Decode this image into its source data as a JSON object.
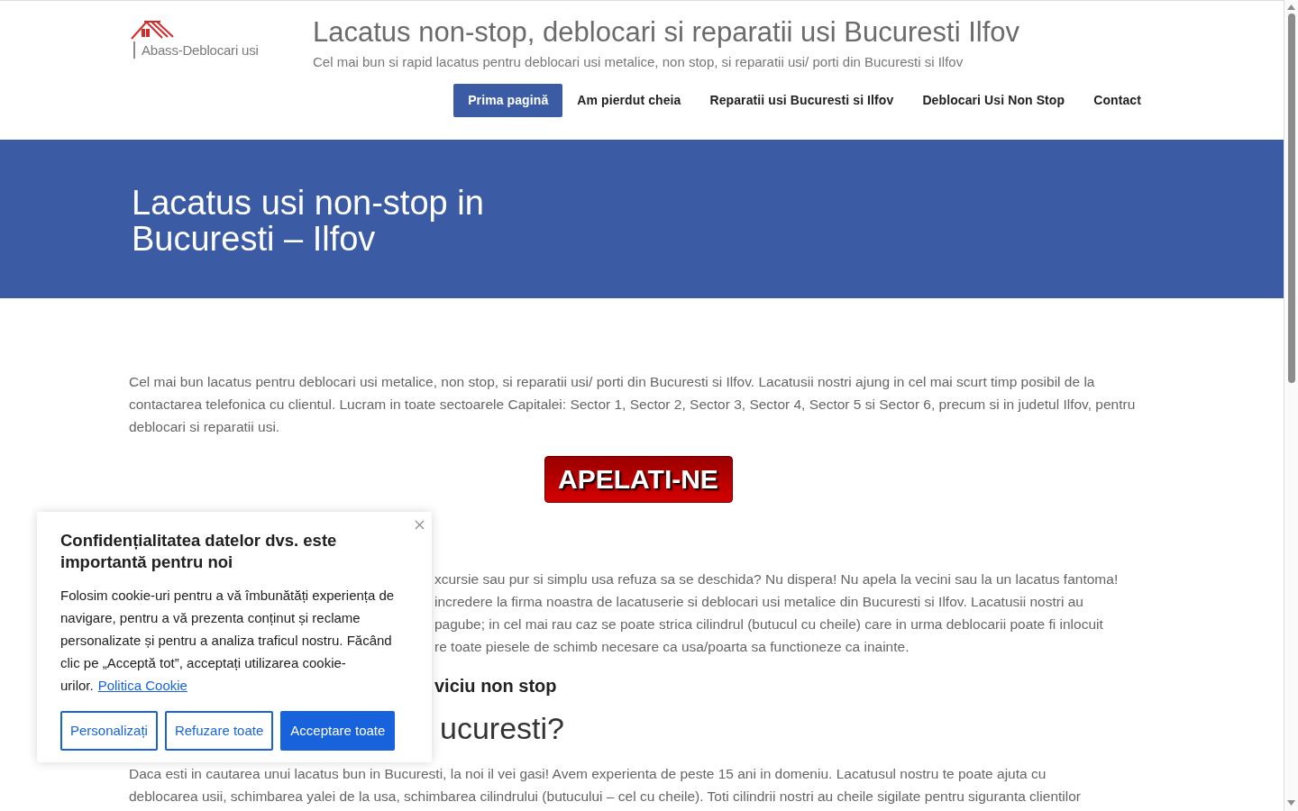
{
  "header": {
    "logo_text": "Abass-Deblocari usi",
    "site_title": "Lacatus non-stop, deblocari si reparatii usi Bucuresti Ilfov",
    "tagline": "Cel mai bun si rapid lacatus pentru deblocari usi metalice, non stop, si reparatii usi/ porti din Bucuresti si Ilfov",
    "nav": [
      {
        "label": "Prima pagină",
        "selected": true
      },
      {
        "label": "Am pierdut cheia",
        "selected": false
      },
      {
        "label": "Reparatii usi Bucuresti si Ilfov",
        "selected": false
      },
      {
        "label": "Deblocari Usi Non Stop",
        "selected": false
      },
      {
        "label": "Contact",
        "selected": false
      }
    ]
  },
  "banner": {
    "title": "Lacatus usi non-stop in Bucuresti – Ilfov"
  },
  "content": {
    "intro": "Cel mai bun lacatus pentru deblocari usi metalice, non stop, si reparatii usi/ porti din Bucuresti si Ilfov. Lacatusii nostri ajung in cel mai scurt timp posibil de la contactarea telefonica cu clientul. Lucram in toate sectoarele Capitalei: Sector 1, Sector 2, Sector 3, Sector 4, Sector 5 si Sector 6, precum si in judetul Ilfov, pentru deblocari si reparatii usi.",
    "call_button": "APELATI-NE",
    "blocks": [
      {
        "kind": "partial_line",
        "text": "xcursie sau pur si simplu usa refuza sa se deschida? Nu dispera! Nu apela la vecini sau la un lacatus fantoma!"
      },
      {
        "kind": "partial_line",
        "text": "incredere la firma noastra de lacatuserie si deblocari usi metalice din Bucuresti si Ilfov. Lacatusii nostri au"
      },
      {
        "kind": "partial_line",
        "text": "pagube; in cel mai rau caz se poate strica cilindrul (butucul cu cheile) care in urma deblocarii poate fi inlocuit"
      },
      {
        "kind": "partial_line",
        "text": "re toate piesele de schimb necesare ca usa/poarta sa functioneze ca inainte."
      },
      {
        "kind": "subheading",
        "text": "viciu non stop"
      },
      {
        "kind": "heading",
        "text": "ucuresti?"
      },
      {
        "kind": "full_line",
        "text": "Daca esti in cautarea unui lacatus bun in Bucuresti, la noi il vei gasi! Avem experienta de peste 15 ani in domeniu. Lacatusul nostru te poate ajuta cu"
      },
      {
        "kind": "full_line",
        "text": "deblocarea usii, schimbarea yalei de la usa, schimbarea cilindrului (butucului – cel cu cheile). Toti cilindrii nostri au cheile sigilate pentru siguranta clientilor"
      }
    ]
  },
  "cookie_dialog": {
    "title": "Confidențialitatea datelor dvs. este importantă pentru noi",
    "message": "Folosim cookie-uri pentru a vă îmbunătăți experiența de navigare, pentru a vă prezenta conținut și reclame personalizate și pentru a analiza traficul nostru. Făcând clic pe „Acceptă tot”, acceptați utilizarea cookie-urilor.",
    "link": "Politica Cookie",
    "buttons": [
      {
        "label": "Personalizați",
        "kind": "outline"
      },
      {
        "label": "Refuzare toate",
        "kind": "outline"
      },
      {
        "label": "Acceptare toate",
        "kind": "filled"
      }
    ]
  }
}
